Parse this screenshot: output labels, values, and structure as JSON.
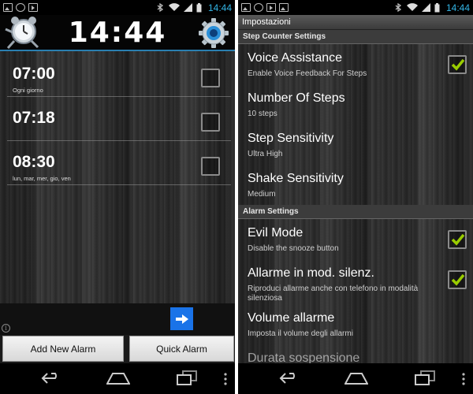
{
  "left_screen": {
    "status_time": "14:44",
    "header": {
      "clock_text": "14:44",
      "app_icon": "running-alarm-clock-icon",
      "settings_icon": "gear-icon"
    },
    "alarms": [
      {
        "time": "07:00",
        "days": "Ogni giorno",
        "enabled": false
      },
      {
        "time": "07:18",
        "days": "",
        "enabled": false
      },
      {
        "time": "08:30",
        "days": "lun, mar, mer, gio, ven",
        "enabled": false
      }
    ],
    "ad": {
      "info_glyph": "i",
      "arrow_icon": "arrow-right-icon"
    },
    "buttons": {
      "add_label": "Add New Alarm",
      "quick_label": "Quick Alarm"
    }
  },
  "right_screen": {
    "status_time": "14:44",
    "title": "Impostazioni",
    "categories": {
      "step_counter": "Step Counter Settings",
      "alarm": "Alarm Settings"
    },
    "step_prefs": [
      {
        "title": "Voice Assistance",
        "summary": "Enable Voice Feedback For Steps",
        "checkbox": true,
        "checked": true
      },
      {
        "title": "Number Of Steps",
        "summary": "10 steps",
        "checkbox": false
      },
      {
        "title": "Step Sensitivity",
        "summary": "Ultra High",
        "checkbox": false
      },
      {
        "title": "Shake Sensitivity",
        "summary": "Medium",
        "checkbox": false
      }
    ],
    "alarm_prefs": [
      {
        "title": "Evil Mode",
        "summary": "Disable the snooze button",
        "checkbox": true,
        "checked": true
      },
      {
        "title": "Allarme in mod. silenz.",
        "summary": "Riproduci allarme anche con telefono in modalità silenziosa",
        "checkbox": true,
        "checked": true
      },
      {
        "title": "Volume allarme",
        "summary": "Imposta il volume degli allarmi",
        "checkbox": false
      },
      {
        "title": "Durata sospensione",
        "summary": "",
        "checkbox": false
      }
    ]
  },
  "colors": {
    "accent_blue": "#33b5e5",
    "check_green": "#99cc00",
    "ad_blue": "#1a73e8"
  }
}
